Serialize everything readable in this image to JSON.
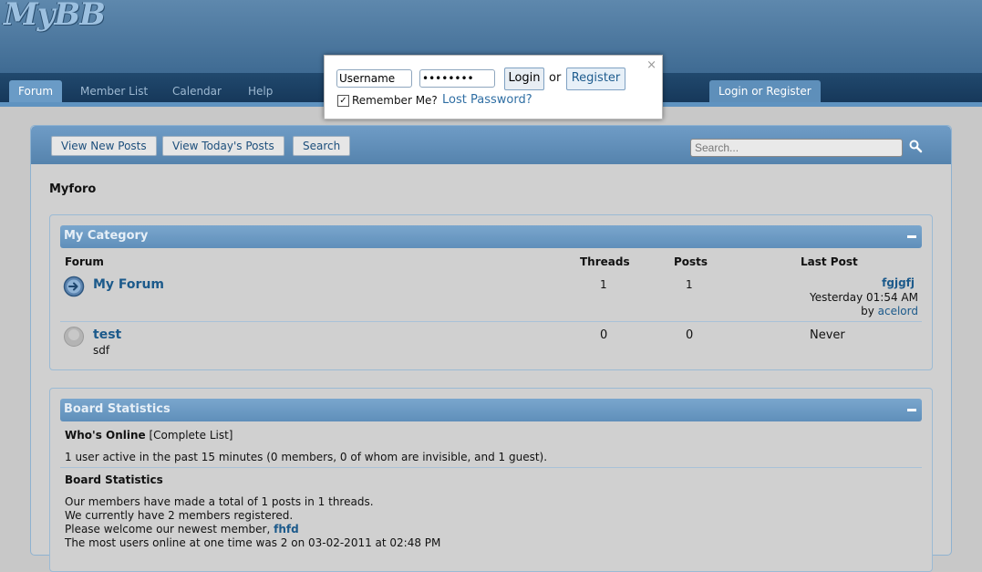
{
  "logo": "MyBB",
  "nav": {
    "tabs": [
      "Forum",
      "Member List",
      "Calendar",
      "Help"
    ],
    "login_register": "Login or Register"
  },
  "login_popup": {
    "username_value": "Username",
    "password_value": "••••••••",
    "login_label": "Login",
    "or_text": "or",
    "register_label": "Register",
    "close_glyph": "×",
    "remember_label": "Remember Me?",
    "remember_checked_glyph": "✓",
    "lost_password": "Lost Password?"
  },
  "toolbar": {
    "view_new_posts": "View New Posts",
    "view_todays_posts": "View Today's Posts",
    "search_button": "Search",
    "search_placeholder": "Search..."
  },
  "board_title": "Myforo",
  "category": {
    "title": "My Category",
    "headers": {
      "forum": "Forum",
      "threads": "Threads",
      "posts": "Posts",
      "last_post": "Last Post"
    },
    "forums": [
      {
        "name": "My Forum",
        "description": "",
        "threads": "1",
        "posts": "1",
        "last_post_title": "fgjgfj",
        "last_post_time": "Yesterday 01:54 AM",
        "by_label": "by",
        "last_post_author": "acelord",
        "status": "new"
      },
      {
        "name": "test",
        "description": "sdf",
        "threads": "0",
        "posts": "0",
        "last_post_never": "Never",
        "status": "none"
      }
    ]
  },
  "stats": {
    "title": "Board Statistics",
    "whos_online_label": "Who's Online",
    "complete_list": "[Complete List]",
    "online_text": "1 user active in the past 15 minutes (0 members, 0 of whom are invisible, and 1 guest).",
    "board_stats_label": "Board Statistics",
    "line1": "Our members have made a total of 1 posts in 1 threads.",
    "line2": "We currently have 2 members registered.",
    "line3_prefix": "Please welcome our newest member, ",
    "newest_member": "fhfd",
    "line4": "The most users online at one time was 2 on 03-02-2011 at 02:48 PM"
  },
  "colors": {
    "header": "#4f7ba3",
    "nav": "#1b3f63",
    "thead": "#6b9bc4",
    "link": "#1c5a8b",
    "background": "#d0d0d0"
  }
}
